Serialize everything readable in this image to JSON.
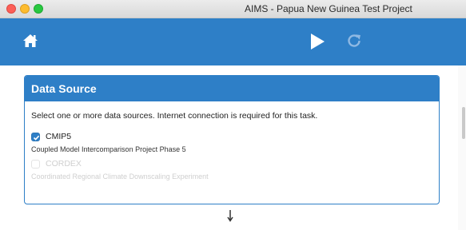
{
  "window": {
    "title": "AIMS - Papua New Guinea Test Project"
  },
  "toolbar": {
    "home_icon": "home-icon",
    "run_icon": "play-icon",
    "refresh_icon": "refresh-icon"
  },
  "panel": {
    "title": "Data Source",
    "instructions": "Select one or more data sources. Internet connection is required for this task.",
    "options": [
      {
        "name": "CMIP5",
        "description": "Coupled Model Intercomparison Project Phase 5",
        "checked": true,
        "enabled": true
      },
      {
        "name": "CORDEX",
        "description": "Coordinated Regional Climate Downscaling Experiment",
        "checked": false,
        "enabled": false
      }
    ]
  },
  "colors": {
    "accent": "#2e7fc7",
    "toolbar_bg": "#2e7fc7",
    "disabled_text": "#cfcfcf"
  }
}
